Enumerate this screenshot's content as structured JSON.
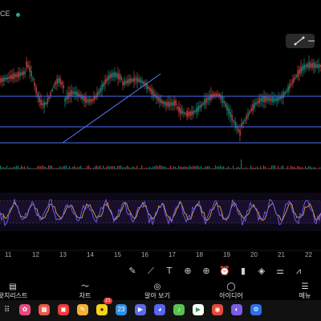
{
  "header": {
    "ticker_fragment": "CE"
  },
  "date_axis": [
    "11",
    "12",
    "13",
    "14",
    "15",
    "16",
    "17",
    "18",
    "19",
    "20",
    "21",
    "22"
  ],
  "toolbar_icons": [
    "pencil-icon",
    "ruler-icon",
    "text-icon",
    "crosshair-icon",
    "add-icon",
    "alarm-icon",
    "candle-type-icon",
    "layers-icon",
    "settings-icon",
    "pattern-icon"
  ],
  "bottom_nav": {
    "items": [
      {
        "name": "watchlist",
        "label": "왓치리스트",
        "icon": "▤"
      },
      {
        "name": "chart",
        "label": "차트",
        "icon": "〜"
      },
      {
        "name": "explore",
        "label": "알아 보기",
        "icon": "◎"
      },
      {
        "name": "ideas",
        "label": "아이디어",
        "icon": "◯"
      },
      {
        "name": "menu",
        "label": "메뉴",
        "icon": "☰"
      }
    ]
  },
  "dock": {
    "apps": [
      {
        "name": "flower-app-icon",
        "color": "#e84a7f",
        "glyph": "✿"
      },
      {
        "name": "calendar-app-icon",
        "color": "#e8594a",
        "glyph": "▦"
      },
      {
        "name": "photos-app-icon",
        "color": "#ee3a3a",
        "glyph": "▣"
      },
      {
        "name": "note-app-icon",
        "color": "#f2b233",
        "glyph": "✎"
      },
      {
        "name": "kakaotalk-app-icon",
        "color": "#f7d417",
        "glyph": "●"
      },
      {
        "name": "calendar2-app-icon",
        "color": "#2f8fe3",
        "glyph": "23"
      },
      {
        "name": "clip-app-icon",
        "color": "#5b6be8",
        "glyph": "▶"
      },
      {
        "name": "discord-app-icon",
        "color": "#5865f2",
        "glyph": "◕"
      },
      {
        "name": "music-app-icon",
        "color": "#5ac24f",
        "glyph": "♪"
      },
      {
        "name": "play-store-app-icon",
        "color": "#ffffff",
        "glyph": "▶"
      },
      {
        "name": "chrome-app-icon",
        "color": "#e34a3a",
        "glyph": "◉"
      },
      {
        "name": "samsung-internet-app-icon",
        "color": "#7b5ce6",
        "glyph": "◐"
      },
      {
        "name": "settings-app-icon",
        "color": "#2d6fe8",
        "glyph": "⚙"
      }
    ],
    "badge": "21"
  },
  "colors": {
    "up": "#26a69a",
    "down": "#ef5350",
    "hline": "#4a6cf7",
    "trendline": "#5a7cff",
    "rsi_main": "#7b5cf0",
    "rsi_signal": "#e8b84a"
  }
}
